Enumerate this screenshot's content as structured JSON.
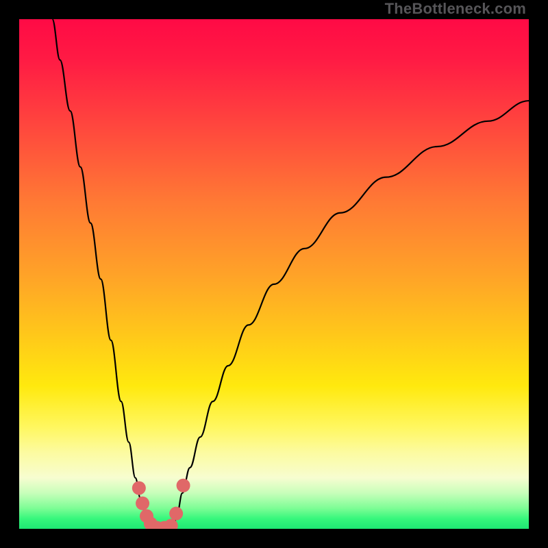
{
  "watermark": "TheBottleneck.com",
  "colors": {
    "frame": "#000000",
    "curve": "#000000",
    "marker_fill": "#e06868",
    "marker_stroke": "#c94f4f",
    "gradient_top": "#ff0a45",
    "gradient_bottom": "#1ee773"
  },
  "chart_data": {
    "type": "line",
    "title": "",
    "xlabel": "",
    "ylabel": "",
    "xlim": [
      0,
      100
    ],
    "ylim": [
      0,
      100
    ],
    "grid": false,
    "legend_position": "none",
    "series": [
      {
        "name": "left-branch",
        "x": [
          6.5,
          8,
          10,
          12,
          14,
          16,
          18,
          20,
          21.5,
          22.8,
          23.8,
          24.6,
          25.3,
          26,
          26.6
        ],
        "y": [
          100,
          92,
          82,
          71,
          60,
          49,
          37,
          25,
          17,
          10,
          6,
          3.5,
          1.8,
          0.6,
          0
        ]
      },
      {
        "name": "right-branch",
        "x": [
          30.2,
          31,
          32,
          33.5,
          35.5,
          38,
          41,
          45,
          50,
          56,
          63,
          72,
          82,
          92,
          100
        ],
        "y": [
          0,
          3,
          7,
          12,
          18,
          25,
          32,
          40,
          48,
          55,
          62,
          69,
          75,
          80,
          84
        ]
      }
    ],
    "valley_floor": {
      "x_range": [
        26.6,
        30.2
      ],
      "y": 0
    },
    "markers": [
      {
        "x": 23.5,
        "y": 8
      },
      {
        "x": 24.2,
        "y": 5
      },
      {
        "x": 25.0,
        "y": 2.5
      },
      {
        "x": 25.8,
        "y": 1.0
      },
      {
        "x": 27.0,
        "y": 0.2
      },
      {
        "x": 28.5,
        "y": 0.2
      },
      {
        "x": 29.8,
        "y": 0.6
      },
      {
        "x": 30.8,
        "y": 3.0
      },
      {
        "x": 32.2,
        "y": 8.5
      }
    ]
  }
}
